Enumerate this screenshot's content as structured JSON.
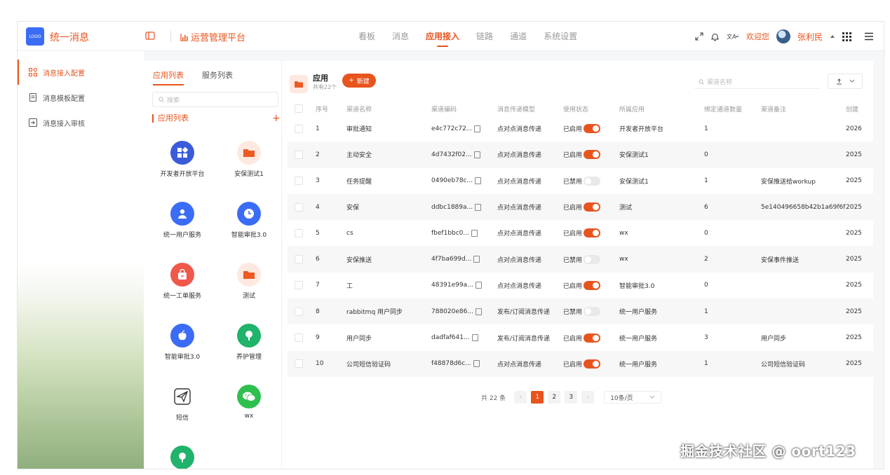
{
  "header": {
    "logo_text": "LOGO",
    "app_name": "统一消息",
    "platform": "运营管理平台",
    "nav": [
      "看板",
      "消息",
      "应用接入",
      "链路",
      "通道",
      "系统设置"
    ],
    "active_nav": "应用接入",
    "welcome": "欢迎您",
    "username": "张利民"
  },
  "sidebar": {
    "items": [
      {
        "label": "消息接入配置",
        "active": true
      },
      {
        "label": "消息模板配置",
        "active": false
      },
      {
        "label": "消息接入审核",
        "active": false
      }
    ]
  },
  "apps": {
    "tabs": [
      "应用列表",
      "服务列表"
    ],
    "search_placeholder": "搜索",
    "section_title": "应用列表",
    "items": [
      {
        "name": "开发者开放平台",
        "icon": "grid-bag-icon",
        "color": "#3b5bdb"
      },
      {
        "name": "安保测试1",
        "icon": "folder-icon",
        "color": "#fde9e0"
      },
      {
        "name": "统一用户服务",
        "icon": "user-icon",
        "color": "#3b6cf5"
      },
      {
        "name": "智能审批3.0",
        "icon": "clock-icon",
        "color": "#3b6cf5"
      },
      {
        "name": "统一工单服务",
        "icon": "bag-icon",
        "color": "#f0584a"
      },
      {
        "name": "测试",
        "icon": "folder-icon",
        "color": "#fde9e0"
      },
      {
        "name": "智能审批3.0",
        "icon": "apple-icon",
        "color": "#3b6cf5"
      },
      {
        "name": "养护管理",
        "icon": "tree-icon",
        "color": "#1fb36b"
      },
      {
        "name": "短信",
        "icon": "send-icon",
        "color": "#ffffff"
      },
      {
        "name": "wx",
        "icon": "wechat-icon",
        "color": "#2ec04f"
      },
      {
        "name": "",
        "icon": "tree-icon",
        "color": "#1fb36b"
      }
    ]
  },
  "table": {
    "title": "应用",
    "subtitle": "共有22个",
    "new_label": "新建",
    "search_placeholder": "渠道名称",
    "columns": [
      "序号",
      "渠道名称",
      "渠道编码",
      "消息传递模型",
      "使用状态",
      "所属应用",
      "绑定通道数量",
      "渠道备注",
      "创建"
    ],
    "rows": [
      {
        "no": "1",
        "name": "审批通知",
        "code": "e4c772c72...",
        "model": "点对点消息传递",
        "status": "已启用",
        "on": true,
        "app": "开发者开放平台",
        "count": "1",
        "note": "",
        "created": "2026"
      },
      {
        "no": "2",
        "name": "主动安全",
        "code": "4d7432f02...",
        "model": "点对点消息传递",
        "status": "已启用",
        "on": true,
        "app": "安保测试1",
        "count": "0",
        "note": "",
        "created": "2025"
      },
      {
        "no": "3",
        "name": "任务提醒",
        "code": "0490eb78c...",
        "model": "点对点消息传递",
        "status": "已禁用",
        "on": false,
        "app": "安保测试1",
        "count": "1",
        "note": "安保推送给workup",
        "created": "2025"
      },
      {
        "no": "4",
        "name": "安保",
        "code": "ddbc1889a...",
        "model": "点对点消息传递",
        "status": "已启用",
        "on": true,
        "app": "测试",
        "count": "6",
        "note": "5e140496658b42b1a69f6f",
        "created": "2025"
      },
      {
        "no": "5",
        "name": "cs",
        "code": "fbef1bbc0...",
        "model": "点对点消息传递",
        "status": "已启用",
        "on": true,
        "app": "wx",
        "count": "0",
        "note": "",
        "created": "2025"
      },
      {
        "no": "6",
        "name": "安保推送",
        "code": "4f7ba699d...",
        "model": "点对点消息传递",
        "status": "已禁用",
        "on": false,
        "app": "wx",
        "count": "2",
        "note": "安保事件推送",
        "created": "2025"
      },
      {
        "no": "7",
        "name": "工",
        "code": "48391e99a...",
        "model": "点对点消息传递",
        "status": "已启用",
        "on": true,
        "app": "智能审批3.0",
        "count": "0",
        "note": "",
        "created": "2025"
      },
      {
        "no": "8",
        "name": "rabbitmq 用户同步",
        "code": "788020e86...",
        "model": "发布/订阅消息传递",
        "status": "已禁用",
        "on": false,
        "app": "统一用户服务",
        "count": "1",
        "note": "",
        "created": "2025"
      },
      {
        "no": "9",
        "name": "用户同步",
        "code": "dadfaf641...",
        "model": "发布/订阅消息传递",
        "status": "已启用",
        "on": true,
        "app": "统一用户服务",
        "count": "3",
        "note": "用户同步",
        "created": "2025"
      },
      {
        "no": "10",
        "name": "公司短信验证码",
        "code": "f48878d6c...",
        "model": "点对点消息传递",
        "status": "已启用",
        "on": true,
        "app": "统一用户服务",
        "count": "1",
        "note": "公司短信验证码",
        "created": "2025"
      }
    ]
  },
  "pagination": {
    "total": "共 22 条",
    "pages": [
      "1",
      "2",
      "3"
    ],
    "current": "1",
    "page_size": "10条/页"
  },
  "watermark": "掘金技术社区 @ oort123",
  "colors": {
    "accent": "#e8541e"
  }
}
